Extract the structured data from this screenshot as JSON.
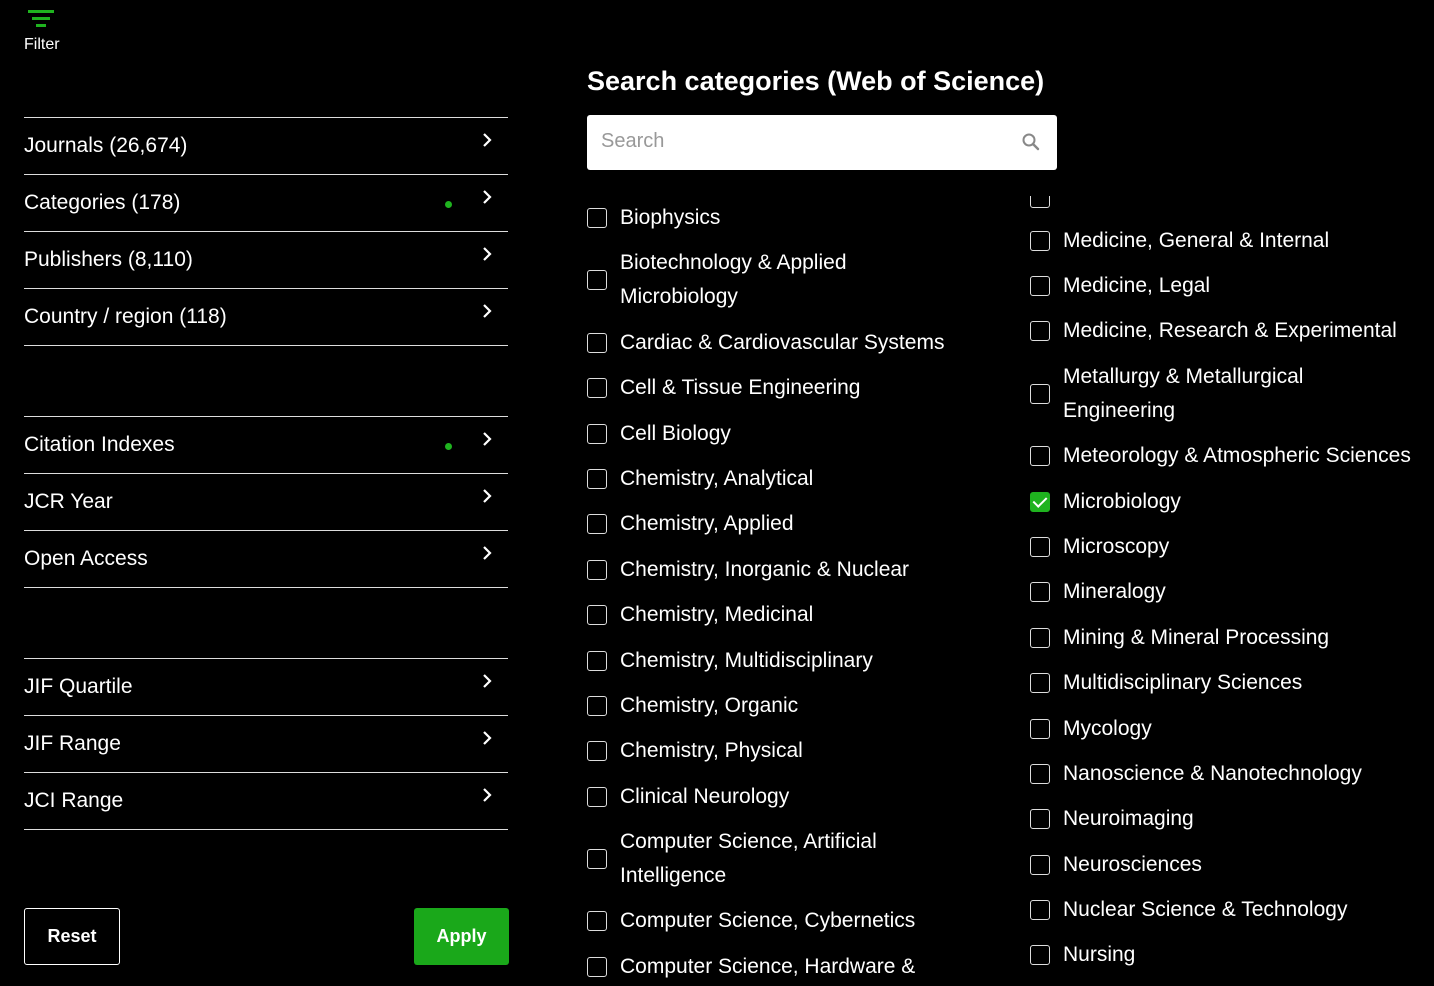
{
  "filter_label": "Filter",
  "sidebar": {
    "group1": [
      {
        "label": "Journals (26,674)",
        "active": false
      },
      {
        "label": "Categories (178)",
        "active": true
      },
      {
        "label": "Publishers (8,110)",
        "active": false
      },
      {
        "label": "Country / region (118)",
        "active": false
      }
    ],
    "group2": [
      {
        "label": "Citation Indexes",
        "active": true
      },
      {
        "label": "JCR Year",
        "active": false
      },
      {
        "label": "Open Access",
        "active": false
      }
    ],
    "group3": [
      {
        "label": "JIF Quartile",
        "active": false
      },
      {
        "label": "JIF Range",
        "active": false
      },
      {
        "label": "JCI Range",
        "active": false
      }
    ]
  },
  "buttons": {
    "reset": "Reset",
    "apply": "Apply"
  },
  "main": {
    "title": "Search categories (Web of Science)",
    "search_placeholder": "Search"
  },
  "categories_left": [
    {
      "label": "Biophysics",
      "checked": false
    },
    {
      "label": "Biotechnology & Applied Microbiology",
      "checked": false
    },
    {
      "label": "Cardiac & Cardiovascular Systems",
      "checked": false
    },
    {
      "label": "Cell & Tissue Engineering",
      "checked": false
    },
    {
      "label": "Cell Biology",
      "checked": false
    },
    {
      "label": "Chemistry, Analytical",
      "checked": false
    },
    {
      "label": "Chemistry, Applied",
      "checked": false
    },
    {
      "label": "Chemistry, Inorganic & Nuclear",
      "checked": false
    },
    {
      "label": "Chemistry, Medicinal",
      "checked": false
    },
    {
      "label": "Chemistry, Multidisciplinary",
      "checked": false
    },
    {
      "label": "Chemistry, Organic",
      "checked": false
    },
    {
      "label": "Chemistry, Physical",
      "checked": false
    },
    {
      "label": "Clinical Neurology",
      "checked": false
    },
    {
      "label": "Computer Science, Artificial Intelligence",
      "checked": false
    },
    {
      "label": "Computer Science, Cybernetics",
      "checked": false
    },
    {
      "label": "Computer Science, Hardware &",
      "checked": false
    }
  ],
  "categories_right": [
    {
      "label": "Medicine, General & Internal",
      "checked": false
    },
    {
      "label": "Medicine, Legal",
      "checked": false
    },
    {
      "label": "Medicine, Research & Experimental",
      "checked": false
    },
    {
      "label": "Metallurgy & Metallurgical Engineering",
      "checked": false
    },
    {
      "label": "Meteorology & Atmospheric Sciences",
      "checked": false
    },
    {
      "label": "Microbiology",
      "checked": true
    },
    {
      "label": "Microscopy",
      "checked": false
    },
    {
      "label": "Mineralogy",
      "checked": false
    },
    {
      "label": "Mining & Mineral Processing",
      "checked": false
    },
    {
      "label": "Multidisciplinary Sciences",
      "checked": false
    },
    {
      "label": "Mycology",
      "checked": false
    },
    {
      "label": "Nanoscience & Nanotechnology",
      "checked": false
    },
    {
      "label": "Neuroimaging",
      "checked": false
    },
    {
      "label": "Neurosciences",
      "checked": false
    },
    {
      "label": "Nuclear Science & Technology",
      "checked": false
    },
    {
      "label": "Nursing",
      "checked": false
    }
  ],
  "colors": {
    "accent": "#1fb31f",
    "background": "#000000",
    "text": "#ffffff"
  },
  "icons": {
    "filter": "filter-lines-icon",
    "chevron": "chevron-right-icon",
    "search": "magnifier-icon"
  }
}
